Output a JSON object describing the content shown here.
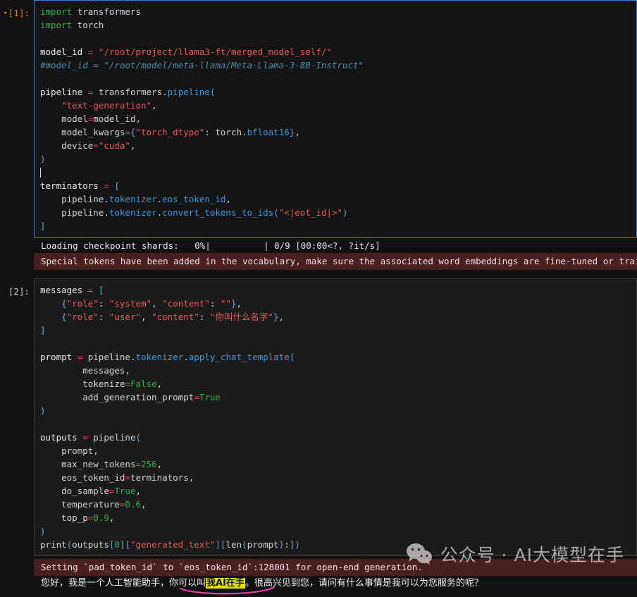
{
  "notebook": {
    "theme": "dark",
    "background_color": "#111111",
    "cells": [
      {
        "id": "cell-1",
        "prompt_label": "[1]:",
        "run_indicator": "•",
        "prompt_color": "#d98326",
        "active": true,
        "border_color": "#2f84d6",
        "source_lines": [
          "import transformers",
          "import torch",
          "",
          "model_id = \"/root/project/llama3-ft/merged_model_self/\"",
          "#model_id = \"/root/model/meta-llama/Meta-Llama-3-8B-Instruct\"",
          "",
          "pipeline = transformers.pipeline(",
          "    \"text-generation\",",
          "    model=model_id,",
          "    model_kwargs={\"torch_dtype\": torch.bfloat16},",
          "    device=\"cuda\",",
          ")",
          "",
          "terminators = [",
          "    pipeline.tokenizer.eos_token_id,",
          "    pipeline.tokenizer.convert_tokens_to_ids(\"<|eot_id|>\")",
          "]"
        ],
        "outputs": {
          "progress_bar": "Loading checkpoint shards:   0%|          | 0/9 [00:00<?, ?it/s]",
          "progress_percent": "0%",
          "progress_count": "0/9",
          "progress_eta": "[00:00<?, ?it/s]",
          "warning": "Special tokens have been added in the vocabulary, make sure the associated word embeddings are fine-tuned or trained.",
          "warning_bg": "#4a1f1f"
        }
      },
      {
        "id": "cell-2",
        "prompt_label": "[2]:",
        "run_indicator": "",
        "prompt_color": "#cfcfcf",
        "active": false,
        "border_color": "#3b3b3b",
        "source_lines": [
          "messages = [",
          "    {\"role\": \"system\", \"content\": \"\"},",
          "    {\"role\": \"user\", \"content\": \"你叫什么名字\"},",
          "]",
          "",
          "prompt = pipeline.tokenizer.apply_chat_template(",
          "        messages,",
          "        tokenize=False,",
          "        add_generation_prompt=True",
          ")",
          "",
          "outputs = pipeline(",
          "    prompt,",
          "    max_new_tokens=256,",
          "    eos_token_id=terminators,",
          "    do_sample=True,",
          "    temperature=0.6,",
          "    top_p=0.9,",
          ")",
          "print(outputs[0][\"generated_text\"][len(prompt):])"
        ],
        "outputs": {
          "warning": "Setting `pad_token_id` to `eos_token_id`:128001 for open-end generation.",
          "warning_bg": "#4a1f1f",
          "answer_prefix": "您好，我是一个人工智能助手，你可以叫",
          "answer_highlight": "我AI在手",
          "answer_suffix": "。很高兴见到您，请问有什么事情是我可以为您服务的呢？",
          "highlight_bg": "#e8e800",
          "highlight_fg": "#111111",
          "underline_color": "#e040a0"
        }
      }
    ]
  },
  "watermark": {
    "icon": "wechat-icon",
    "text": "公众号 · AI大模型在手",
    "color": "#ffffff"
  }
}
